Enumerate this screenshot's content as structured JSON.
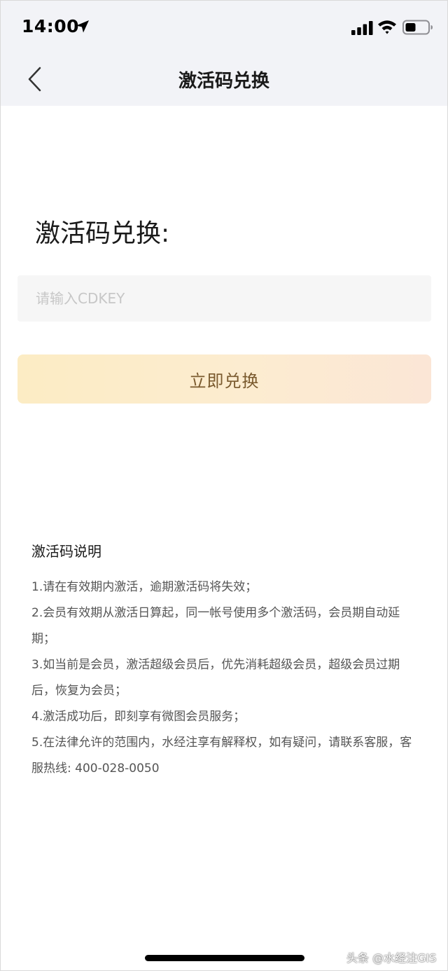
{
  "status_bar": {
    "time": "14:00",
    "icons": [
      "location-arrow-icon",
      "cellular-signal-icon",
      "wifi-icon",
      "battery-icon"
    ]
  },
  "nav": {
    "back_icon": "chevron-left-icon",
    "title": "激活码兑换"
  },
  "form": {
    "heading": "激活码兑换:",
    "input_placeholder": "请输入CDKEY",
    "input_value": "",
    "submit_label": "立即兑换"
  },
  "instructions": {
    "title": "激活码说明",
    "items": [
      "1.请在有效期内激活，逾期激活码将失效；",
      "2.会员有效期从激活日算起，同一帐号使用多个激活码，会员期自动延期；",
      "3.如当前是会员，激活超级会员后，优先消耗超级会员，超级会员过期后，恢复为会员；",
      "4.激活成功后，即刻享有微图会员服务；",
      "5.在法律允许的范围内，水经注享有解释权，如有疑问，请联系客服，客服热线: 400-028-0050"
    ]
  },
  "watermark": "头条 @水经注GIS",
  "colors": {
    "header_bg": "#f2f3f7",
    "button_gradient_start": "#fcecc4",
    "button_gradient_end": "#fbe6d6",
    "button_text": "#7a5a2e",
    "input_bg": "#f6f6f6"
  }
}
